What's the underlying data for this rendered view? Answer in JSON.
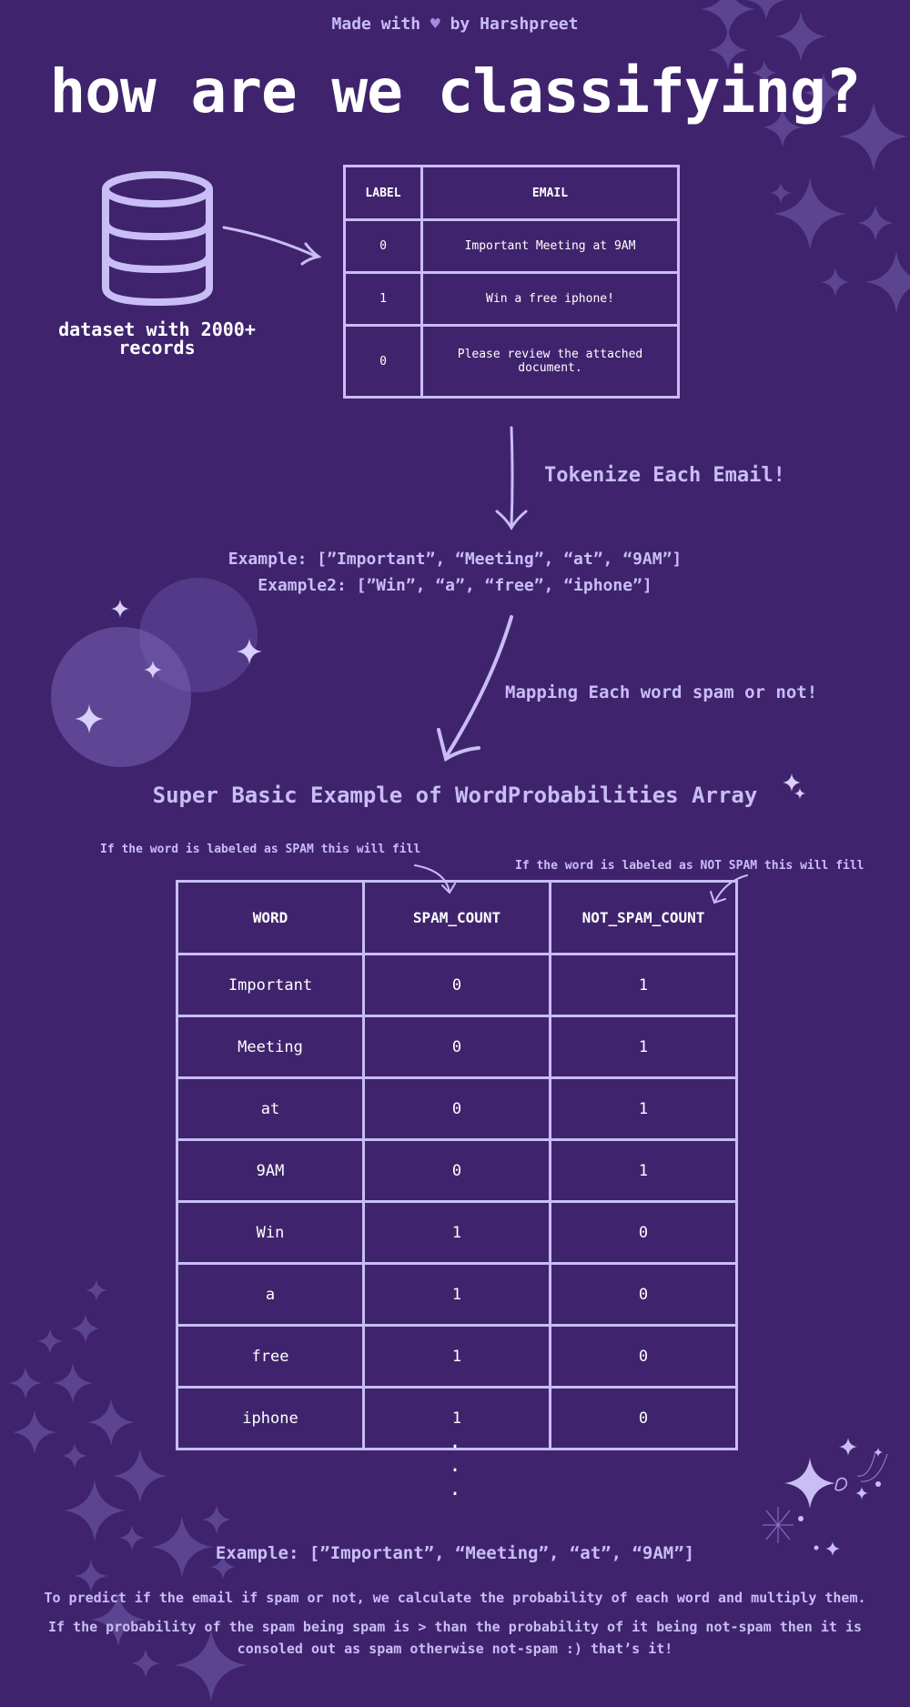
{
  "colors": {
    "background": "#3f246d",
    "accent": "#c9bdf5",
    "sparkle": "#5c4590",
    "heart": "#a98ae0",
    "text": "#ffffff"
  },
  "header": {
    "credit_prefix": "Made with",
    "credit_icon": "heart-icon",
    "credit_suffix": "by Harshpreet",
    "title": "how are we classifying?"
  },
  "dataset": {
    "icon": "database-icon",
    "label_line1": "dataset with 2000+",
    "label_line2": "records"
  },
  "email_table": {
    "headers": [
      "LABEL",
      "EMAIL"
    ],
    "rows": [
      {
        "label": "0",
        "email": "Important Meeting at 9AM"
      },
      {
        "label": "1",
        "email": "Win a free iphone!"
      },
      {
        "label": "0",
        "email": "Please review the attached document."
      }
    ]
  },
  "steps": {
    "tokenize": "Tokenize Each Email!",
    "example1": "Example: [”Important”, “Meeting”, “at”, “9AM”]",
    "example2": "Example2: [”Win”, “a”, “free”, “iphone”]",
    "mapping": "Mapping Each word spam or not!"
  },
  "word_table": {
    "title": "Super Basic Example of WordProbabilities Array",
    "note_spam": "If the word is labeled as SPAM this will fill",
    "note_not_spam": "If the word is labeled as NOT SPAM this will fill",
    "headers": [
      "WORD",
      "SPAM_COUNT",
      "NOT_SPAM_COUNT"
    ],
    "rows": [
      {
        "word": "Important",
        "spam": "0",
        "not_spam": "1"
      },
      {
        "word": "Meeting",
        "spam": "0",
        "not_spam": "1"
      },
      {
        "word": "at",
        "spam": "0",
        "not_spam": "1"
      },
      {
        "word": "9AM",
        "spam": "0",
        "not_spam": "1"
      },
      {
        "word": "Win",
        "spam": "1",
        "not_spam": "0"
      },
      {
        "word": "a",
        "spam": "1",
        "not_spam": "0"
      },
      {
        "word": "free",
        "spam": "1",
        "not_spam": "0"
      },
      {
        "word": "iphone",
        "spam": "1",
        "not_spam": "0"
      }
    ],
    "continuation": "⋮"
  },
  "footer": {
    "example": "Example: [”Important”, “Meeting”, “at”, “9AM”]",
    "para1": "To predict if the email if spam or not, we calculate the probability of each word and multiply them.",
    "para2": "If the probability of the spam being spam is > than the probability of it being not-spam then it is consoled out as spam otherwise not-spam :) that’s it!"
  }
}
